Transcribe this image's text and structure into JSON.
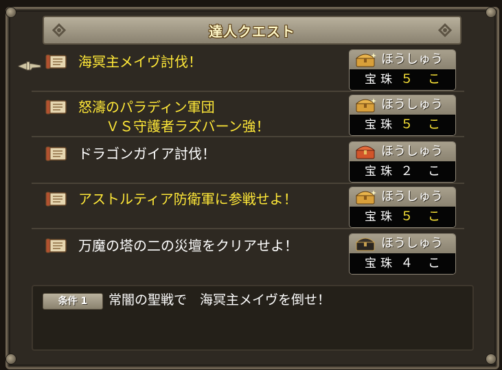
{
  "window": {
    "title": "達人クエスト"
  },
  "quests": [
    {
      "label": "海冥主メイヴ討伐！",
      "completed": true,
      "reward_header": "ほうしゅう",
      "reward_item": "宝珠",
      "reward_count": "５ こ",
      "chest": "gold-chest-icon"
    },
    {
      "label": "怒濤のパラディン軍団\n　　ＶＳ守護者ラズバーン強！",
      "completed": true,
      "reward_header": "ほうしゅう",
      "reward_item": "宝珠",
      "reward_count": "５ こ",
      "chest": "gold-chest-icon"
    },
    {
      "label": "ドラゴンガイア討伐！",
      "completed": false,
      "reward_header": "ほうしゅう",
      "reward_item": "宝珠",
      "reward_count": "２ こ",
      "chest": "red-chest-icon"
    },
    {
      "label": "アストルティア防衛軍に参戦せよ！",
      "completed": true,
      "reward_header": "ほうしゅう",
      "reward_item": "宝珠",
      "reward_count": "５ こ",
      "chest": "gold-chest-icon"
    },
    {
      "label": "万魔の塔の二の災壇をクリアせよ！",
      "completed": false,
      "reward_header": "ほうしゅう",
      "reward_item": "宝珠",
      "reward_count": "４ こ",
      "chest": "black-chest-icon"
    }
  ],
  "condition": {
    "badge": "条件 1",
    "text": "常闇の聖戦で　海冥主メイヴを倒せ！"
  },
  "colors": {
    "completed": "#ffe838",
    "incomplete": "#ffffff",
    "panel": "#2e2922",
    "gold_chest": "#d9a03a",
    "red_chest": "#d2552a",
    "black_chest": "#2a2520"
  }
}
